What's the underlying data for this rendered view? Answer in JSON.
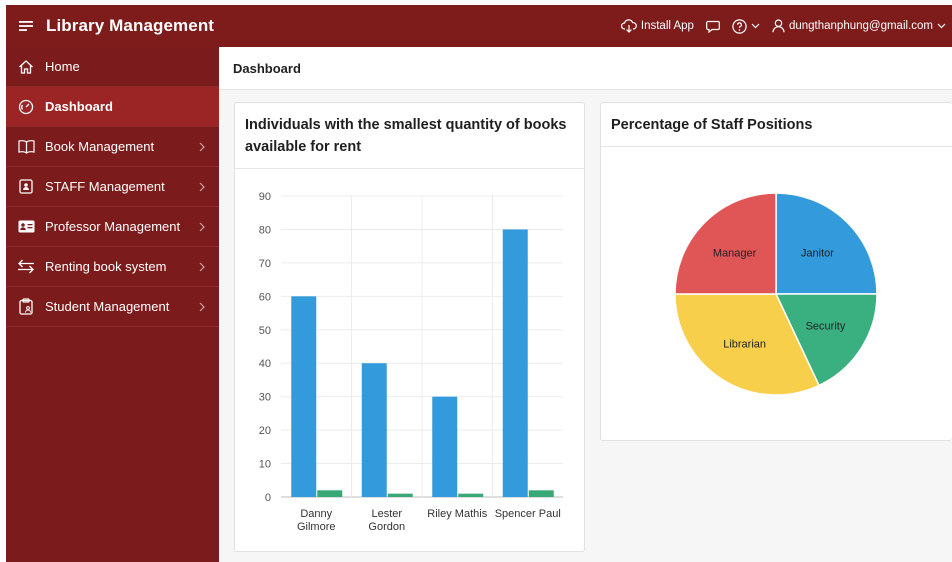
{
  "header": {
    "app_title": "Library Management",
    "install_label": "Install App",
    "user_email": "dungthanphung@gmail.com"
  },
  "sidebar": {
    "items": [
      {
        "label": "Home",
        "icon": "home-icon",
        "active": false,
        "has_children": false
      },
      {
        "label": "Dashboard",
        "icon": "dashboard-gauge-icon",
        "active": true,
        "has_children": false
      },
      {
        "label": "Book Management",
        "icon": "book-icon",
        "active": false,
        "has_children": true
      },
      {
        "label": "STAFF Management",
        "icon": "staff-badge-icon",
        "active": false,
        "has_children": true
      },
      {
        "label": "Professor Management",
        "icon": "id-card-icon",
        "active": false,
        "has_children": true
      },
      {
        "label": "Renting book system",
        "icon": "swap-arrows-icon",
        "active": false,
        "has_children": true
      },
      {
        "label": "Student Management",
        "icon": "clipboard-user-icon",
        "active": false,
        "has_children": true
      }
    ]
  },
  "breadcrumb": {
    "title": "Dashboard"
  },
  "colors": {
    "header_bg": "#7e1b1b",
    "sidebar_bg": "#7c1b1b",
    "sidebar_active": "#9b2525",
    "bar_primary": "#339bdb",
    "bar_secondary": "#3aa876",
    "pie_manager": "#e05656",
    "pie_janitor": "#339bdb",
    "pie_security": "#3aaf80",
    "pie_librarian": "#f7cf4a"
  },
  "chart_data": [
    {
      "type": "bar",
      "title": "Individuals with the smallest quantity of books available for rent",
      "categories": [
        "Danny Gilmore",
        "Lester Gordon",
        "Riley Mathis",
        "Spencer Paul"
      ],
      "category_lines": [
        [
          "Danny",
          "Gilmore"
        ],
        [
          "Lester",
          "Gordon"
        ],
        [
          "Riley Mathis"
        ],
        [
          "Spencer Paul"
        ]
      ],
      "series": [
        {
          "values": [
            60,
            40,
            30,
            80
          ],
          "color": "#339bdb"
        },
        {
          "values": [
            2,
            1,
            1,
            2
          ],
          "color": "#3aa876"
        }
      ],
      "ylim": [
        0,
        90
      ],
      "yticks": [
        0,
        10,
        20,
        30,
        40,
        50,
        60,
        70,
        80,
        90
      ],
      "grid": true
    },
    {
      "type": "pie",
      "title": "Percentage of Staff Positions",
      "slices": [
        {
          "label": "Janitor",
          "value": 25,
          "color": "#339bdb"
        },
        {
          "label": "Security",
          "value": 18,
          "color": "#3aaf80"
        },
        {
          "label": "Librarian",
          "value": 32,
          "color": "#f7cf4a"
        },
        {
          "label": "Manager",
          "value": 25,
          "color": "#e05656"
        }
      ],
      "start": "top",
      "direction": "clockwise"
    }
  ]
}
